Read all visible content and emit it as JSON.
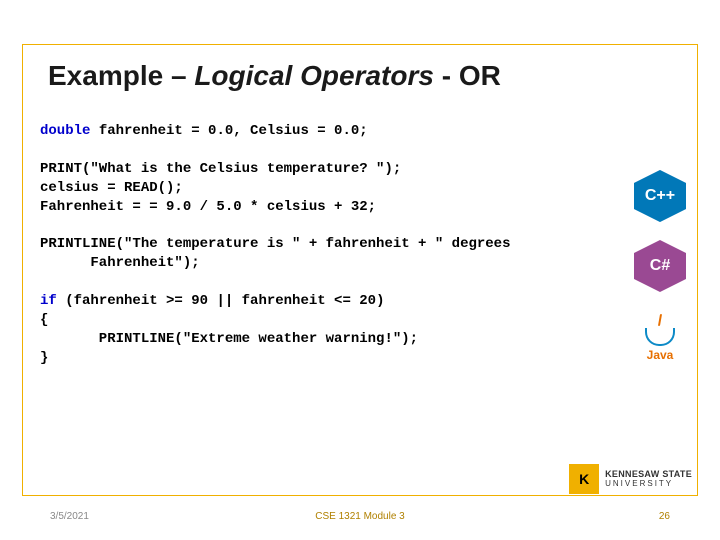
{
  "title": {
    "part1": "Example – ",
    "italic": "Logical Operators ",
    "part3": "- OR"
  },
  "code": {
    "l1_kw": "double",
    "l1_rest": " fahrenheit = 0.0, Celsius = 0.0;",
    "l2": "PRINT(\"What is the Celsius temperature? \");",
    "l3": "celsius = READ();",
    "l4": "Fahrenheit = = 9.0 / 5.0 * celsius + 32;",
    "l5a": "PRINTLINE(\"The temperature is \" + fahrenheit + \" degrees",
    "l5b": "      Fahrenheit\");",
    "l6_kw": "if",
    "l6_rest": " (fahrenheit >= 90 || fahrenheit <= 20)",
    "l7": "{",
    "l8": "       PRINTLINE(\"Extreme weather warning!\");",
    "l9": "}"
  },
  "icons": {
    "cpp": "C++",
    "csharp": "C#",
    "java": "Java"
  },
  "ksu": {
    "mark": "K",
    "line1": "KENNESAW STATE",
    "line2": "UNIVERSITY"
  },
  "footer": {
    "date": "3/5/2021",
    "center": "CSE 1321 Module 3",
    "page": "26"
  }
}
